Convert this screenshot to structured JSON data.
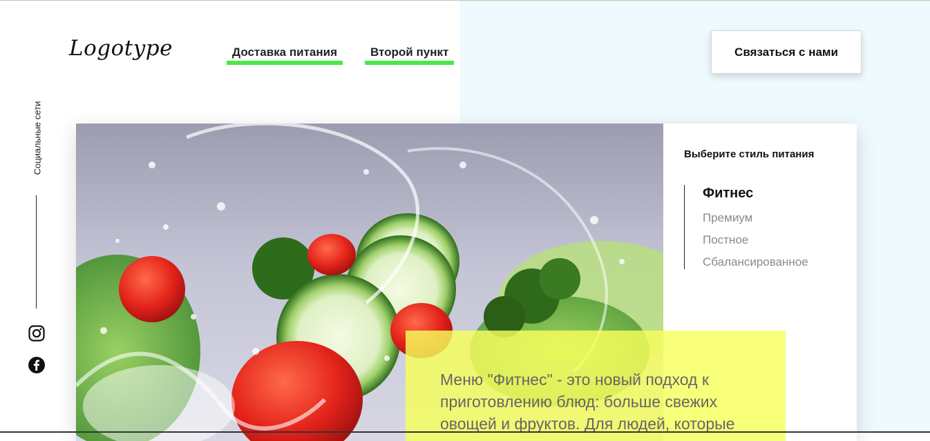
{
  "header": {
    "logo": "Logotype",
    "nav": [
      {
        "label": "Доставка питания"
      },
      {
        "label": "Второй пункт"
      }
    ],
    "contact_button": "Связаться с нами"
  },
  "social": {
    "label": "Социальные сети",
    "icons": [
      "instagram-icon",
      "facebook-icon"
    ]
  },
  "panel": {
    "title": "Выберите стиль питания",
    "styles": [
      {
        "label": "Фитнес",
        "active": true
      },
      {
        "label": "Премиум",
        "active": false
      },
      {
        "label": "Постное",
        "active": false
      },
      {
        "label": "Сбалансированное",
        "active": false
      }
    ]
  },
  "description": "Меню \"Фитнес\" - это новый подход к приготовлению блюд: больше свежих овощей и фруктов. Для людей, которые",
  "colors": {
    "accent_green": "#4ee64a",
    "highlight_yellow": "#f7ff5a",
    "right_background": "#eefafd"
  }
}
